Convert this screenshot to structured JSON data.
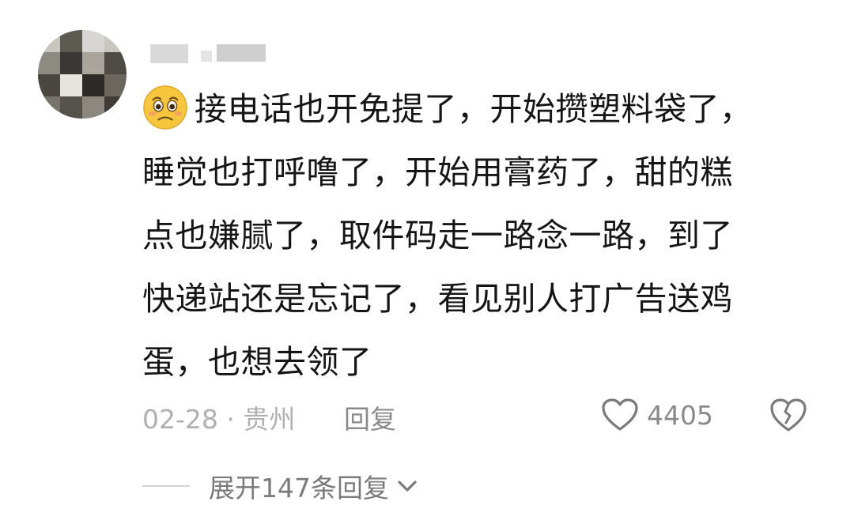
{
  "comment": {
    "lines": [
      "接电话也开免提了，开始攒塑料袋了，",
      "睡觉也打呼噜了，开始用膏药了，甜的糕",
      "点也嫌腻了，取件码走一路念一路，到了",
      "快递站还是忘记了，看见别人打广告送鸡",
      "蛋，也想去领了"
    ],
    "emoji": "pleading-face-icon"
  },
  "meta": {
    "date_location": "02-28 · 贵州",
    "reply_label": "回复",
    "like_count": "4405"
  },
  "expand": {
    "label": "展开147条回复"
  },
  "colors": {
    "text": "#151515",
    "meta": "#a6a6a6",
    "icon": "#7a7a7a"
  }
}
